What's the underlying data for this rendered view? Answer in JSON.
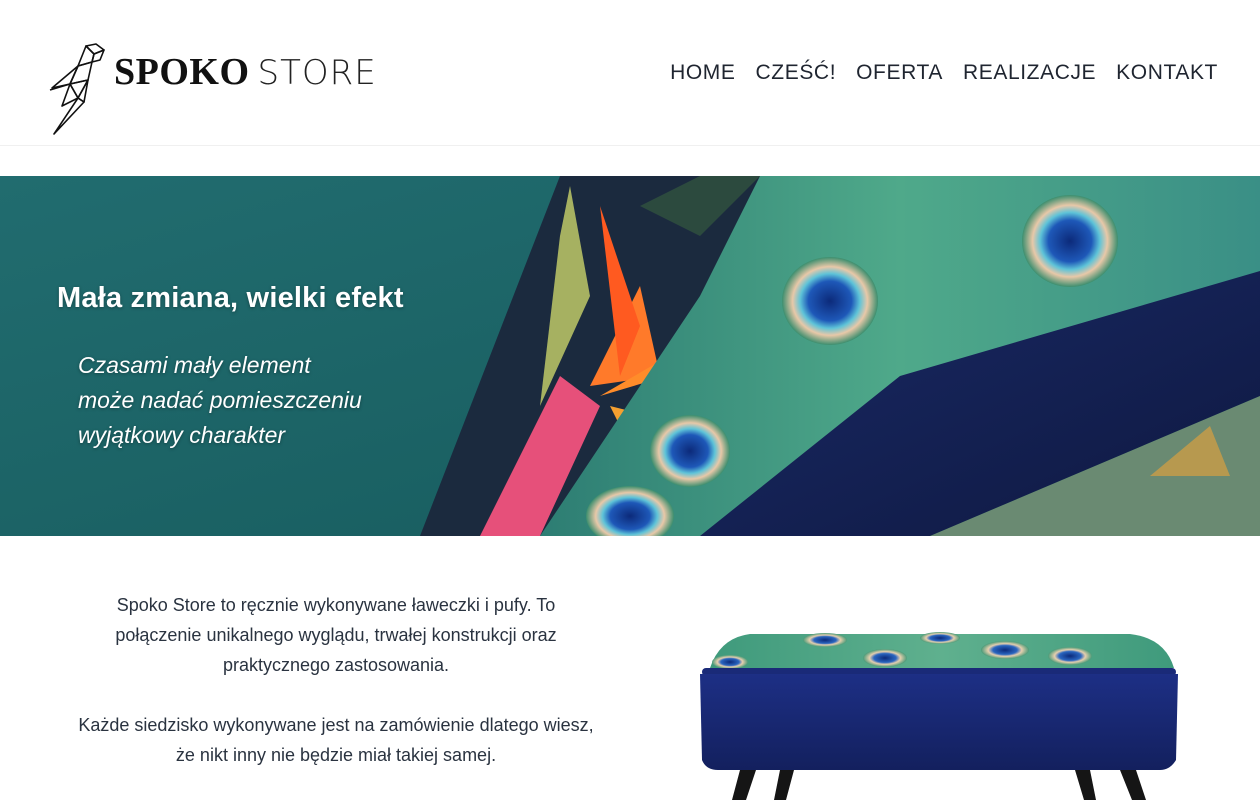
{
  "brand": {
    "name_bold": "SPOKO",
    "name_light": "STORE",
    "logo_icon": "origami-parrot-icon"
  },
  "nav": {
    "items": [
      {
        "label": "HOME"
      },
      {
        "label": "CZEŚĆ!"
      },
      {
        "label": "OFERTA"
      },
      {
        "label": "REALIZACJE"
      },
      {
        "label": "KONTAKT"
      }
    ]
  },
  "hero": {
    "title": "Mała zmiana, wielki efekt",
    "subtitle_lines": [
      "Czasami mały element",
      "może nadać pomieszczeniu",
      "wyjątkowy charakter"
    ]
  },
  "intro": {
    "paragraph1": "Spoko Store to ręcznie wykonywane ławeczki i pufy. To połączenie unikalnego wyglądu, trwałej konstrukcji oraz praktycznego zastosowania.",
    "paragraph2": "Każde siedzisko wykonywane jest na zamówienie dlatego wiesz, że nikt inny nie będzie miał takiej samej."
  },
  "colors": {
    "teal_background": "#1c6466",
    "navy_velvet": "#15235a",
    "peacock_green": "#3f9a7c",
    "text_dark": "#2a3340"
  }
}
